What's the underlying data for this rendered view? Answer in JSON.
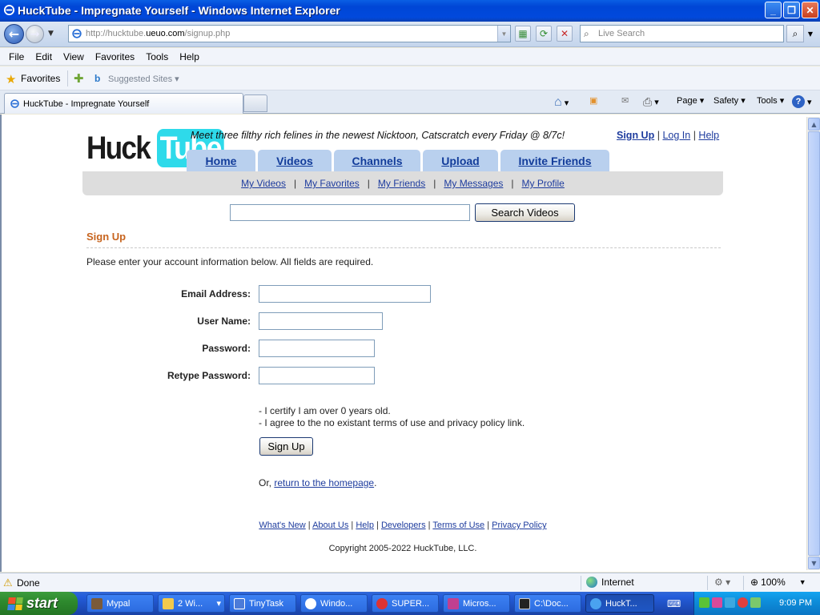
{
  "window": {
    "title": "HuckTube - Impregnate Yourself - Windows Internet Explorer"
  },
  "addressbar": {
    "url_prefix": "http://hucktube.",
    "url_domain": "ueuo.com",
    "url_suffix": "/signup.php",
    "search_placeholder": "Live Search"
  },
  "menubar": {
    "items": [
      "File",
      "Edit",
      "View",
      "Favorites",
      "Tools",
      "Help"
    ]
  },
  "favoritesbar": {
    "favorites_label": "Favorites",
    "suggested_label": "Suggested Sites"
  },
  "tabs": {
    "active_title": "HuckTube - Impregnate Yourself"
  },
  "commandbar": {
    "page": "Page",
    "safety": "Safety",
    "tools": "Tools"
  },
  "site": {
    "logo_part1": "Huck",
    "logo_part2": "Tube",
    "tagline": "Meet three filthy rich felines in the newest Nicktoon, Catscratch every Friday @ 8/7c!",
    "toplinks": {
      "signup": "Sign Up",
      "login": "Log In",
      "help": "Help",
      "sep": "|"
    },
    "nav": [
      "Home",
      "Videos",
      "Channels",
      "Upload",
      "Invite Friends"
    ],
    "subnav": [
      "My Videos",
      "My Favorites",
      "My Friends",
      "My Messages",
      "My Profile"
    ],
    "subnav_sep": "|",
    "search_button": "Search Videos"
  },
  "signup": {
    "heading": "Sign Up",
    "intro": "Please enter your account information below. All fields are required.",
    "fields": {
      "email": "Email Address:",
      "username": "User Name:",
      "password": "Password:",
      "retype": "Retype Password:"
    },
    "terms_line1": "- I certify I am over 0 years old.",
    "terms_line2": "- I agree to the no existant terms of use and privacy policy link.",
    "button": "Sign Up",
    "or_prefix": "Or, ",
    "return_link": "return to the homepage",
    "or_suffix": "."
  },
  "footer": {
    "links": [
      "What's New",
      "About Us",
      "Help",
      "Developers",
      "Terms of Use",
      "Privacy Policy"
    ],
    "sep": "|",
    "copyright": "Copyright 2005-2022 HuckTube, LLC."
  },
  "statusbar": {
    "status": "Done",
    "zone": "Internet",
    "zoom": "100%"
  },
  "taskbar": {
    "start": "start",
    "tasks": [
      "Mypal",
      "2 Wi...",
      "TinyTask",
      "Windo...",
      "SUPER...",
      "Micros...",
      "C:\\Doc...",
      "HuckT..."
    ],
    "clock": "9:09 PM"
  }
}
